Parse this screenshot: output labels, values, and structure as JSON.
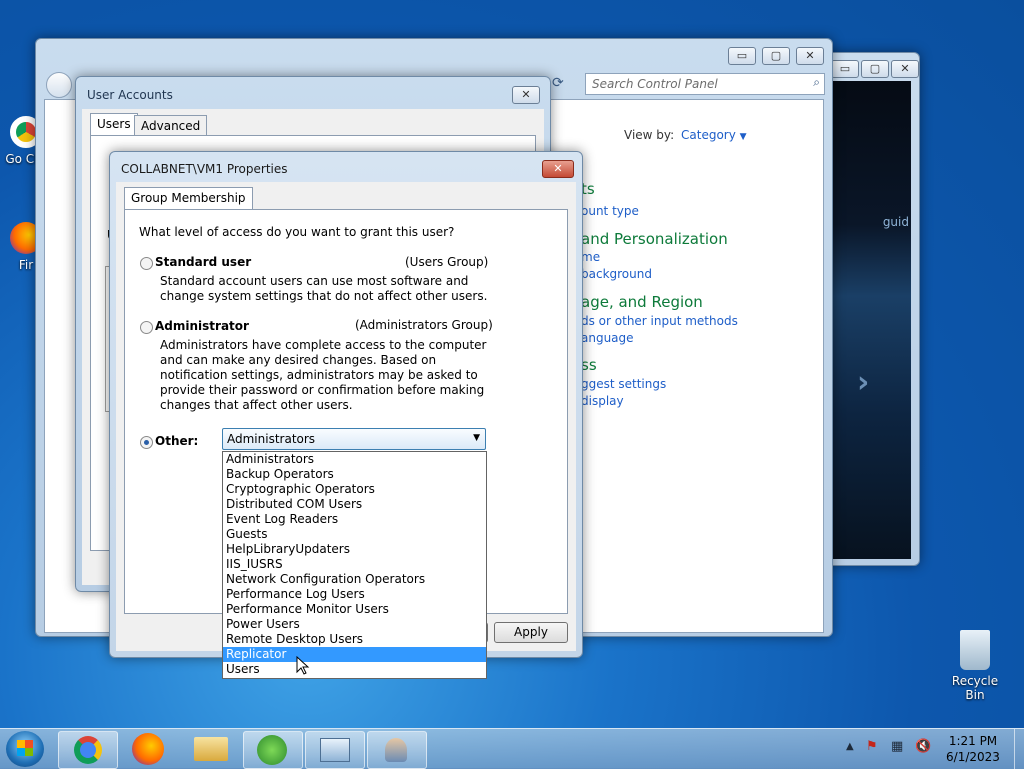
{
  "desktop": {
    "icons": [
      {
        "label": "Go Chr"
      },
      {
        "label": "Fir"
      },
      {
        "label": "Recycle Bin"
      }
    ]
  },
  "control_panel": {
    "search_placeholder": "Search Control Panel",
    "view_by_label": "View by:",
    "view_by_value": "Category",
    "frag_heading_1": "ts",
    "frag_link_1": "ount type",
    "frag_heading_2": "and Personalization",
    "frag_link_2a": "me",
    "frag_link_2b": "background",
    "frag_heading_3": "age, and Region",
    "frag_link_3a": "ds or other input methods",
    "frag_link_3b": "anguage",
    "frag_heading_4": "ss",
    "frag_link_4a": "ggest settings",
    "frag_link_4b": "display"
  },
  "media_window": {
    "overlay_text": "guid"
  },
  "user_accounts": {
    "title": "User Accounts",
    "tabs": [
      "Users",
      "Advanced"
    ],
    "frag_u": "U"
  },
  "properties": {
    "title": "COLLABNET\\VM1 Properties",
    "tab": "Group Membership",
    "question": "What level of access do you want to grant this user?",
    "standard": {
      "label": "Standard user",
      "group": "(Users Group)",
      "desc": "Standard account users can use most software and change system settings that do not affect other users."
    },
    "administrator": {
      "label": "Administrator",
      "group": "(Administrators Group)",
      "desc": "Administrators have complete access to the computer and can make any desired changes. Based on notification settings, administrators may be asked to provide their password or confirmation before making changes that affect other users."
    },
    "other": {
      "label": "Other:",
      "selected": "Administrators",
      "options": [
        "Administrators",
        "Backup Operators",
        "Cryptographic Operators",
        "Distributed COM Users",
        "Event Log Readers",
        "Guests",
        "HelpLibraryUpdaters",
        "IIS_IUSRS",
        "Network Configuration Operators",
        "Performance Log Users",
        "Performance Monitor Users",
        "Power Users",
        "Remote Desktop Users",
        "Replicator",
        "Users"
      ],
      "highlighted": "Replicator"
    },
    "apply_label": "Apply"
  },
  "taskbar": {
    "time": "1:21 PM",
    "date": "6/1/2023",
    "items": [
      "start-orb",
      "chrome",
      "firefox",
      "file-explorer",
      "windows-media",
      "control-panel",
      "user-accounts"
    ]
  },
  "colors": {
    "link": "#1e5ec8",
    "heading_green": "#0d7a3a",
    "selection": "#3399ff"
  }
}
